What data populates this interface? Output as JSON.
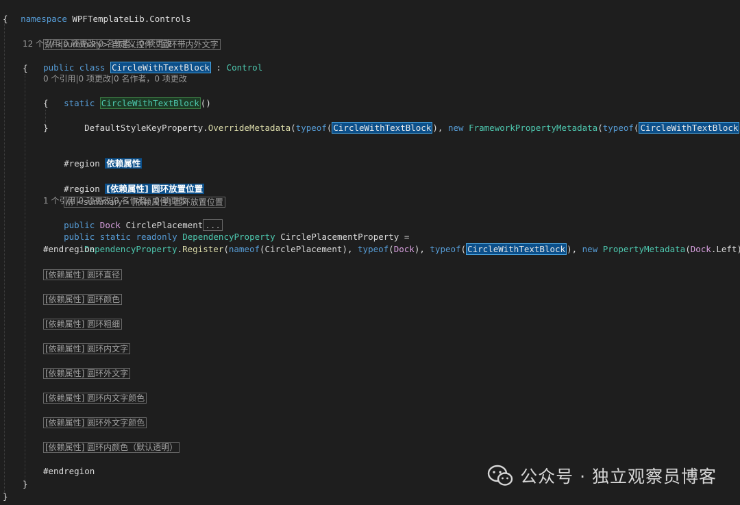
{
  "code": {
    "namespace_kw": "namespace",
    "namespace_name": "WPFTemplateLib.Controls",
    "open_brace": "{",
    "close_brace": "}",
    "class_summary": "/// <summary> 自定义控件：圆环带内外文字",
    "class_lens": "12 个引用|0 项更改|0 名作者，0 项更改",
    "kw_public": "public",
    "kw_class": "class",
    "class_name": "CircleWithTextBlock",
    "colon": " : ",
    "base_class": "Control",
    "ctor_lens": "0 个引用|0 项更改|0 名作者，0 项更改",
    "kw_static": "static",
    "ctor_name": "CircleWithTextBlock",
    "ctor_parens": "()",
    "override_call_a": "DefaultStyleKeyProperty.",
    "override_fn": "OverrideMetadata",
    "p_open": "(",
    "kw_typeof": "typeof",
    "cls_ref": "CircleWithTextBlock",
    "p_close_comma": "), ",
    "kw_new": "new",
    "fpm": "FrameworkPropertyMetadata",
    "p_close_end": ")));",
    "region1_kw": "#region",
    "region1_title": "依赖属性",
    "region2_kw": "#region",
    "region2_title": "[依赖属性] 圆环放置位置",
    "prop_summary": "/// <summary> [依赖属性] 圆环放置位置",
    "prop_lens": "1 个引用|0 项更改|0 名作者，0 项更改",
    "dock_type": "Dock",
    "prop_name": "CirclePlacement",
    "collapsed": "...",
    "kw_readonly": "readonly",
    "dp_type": "DependencyProperty",
    "dp_field": "CirclePlacementProperty =",
    "register_fn": "Register",
    "kw_nameof": "nameof",
    "nameof_arg": "CirclePlacement",
    "pm_type": "PropertyMetadata",
    "dock_left_member": "Left",
    "endregion": "#endregion",
    "collapsed_regions": [
      "[依赖属性] 圆环直径",
      "[依赖属性] 圆环颜色",
      "[依赖属性] 圆环粗细",
      "[依赖属性] 圆环内文字",
      "[依赖属性] 圆环外文字",
      "[依赖属性] 圆环内文字颜色",
      "[依赖属性] 圆环外文字颜色",
      "[依赖属性] 圆环内颜色（默认透明）"
    ]
  },
  "watermark": {
    "text": "公众号 · 独立观察员博客",
    "icon": "wechat-icon"
  }
}
